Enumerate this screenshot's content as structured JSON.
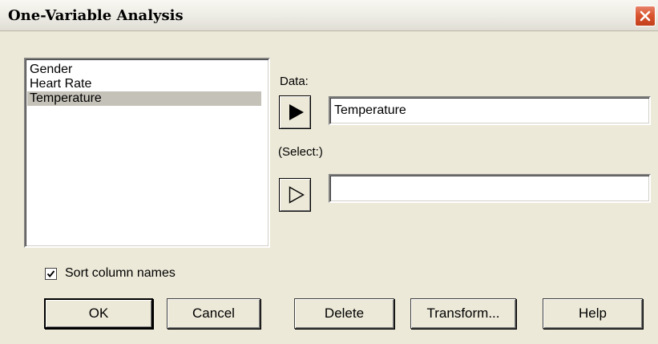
{
  "window": {
    "title": "One-Variable Analysis"
  },
  "columns_list": {
    "items": [
      {
        "label": "Gender",
        "selected": false
      },
      {
        "label": "Heart Rate",
        "selected": false
      },
      {
        "label": "Temperature",
        "selected": true
      }
    ]
  },
  "data_field": {
    "label": "Data:",
    "value": "Temperature"
  },
  "select_field": {
    "label": "(Select:)",
    "value": ""
  },
  "sort_option": {
    "label": "Sort column names",
    "checked": true
  },
  "buttons": {
    "ok": "OK",
    "cancel": "Cancel",
    "delete": "Delete",
    "transform": "Transform...",
    "help": "Help"
  },
  "icons": {
    "close": "close-icon",
    "data_arrow": "filled-right-arrow-icon",
    "select_arrow": "outline-right-arrow-icon",
    "checkmark": "checkmark-icon"
  },
  "colors": {
    "dialog_background": "#ece9d8",
    "close_button": "#d9552e",
    "selection_highlight": "#c4c1b8"
  }
}
